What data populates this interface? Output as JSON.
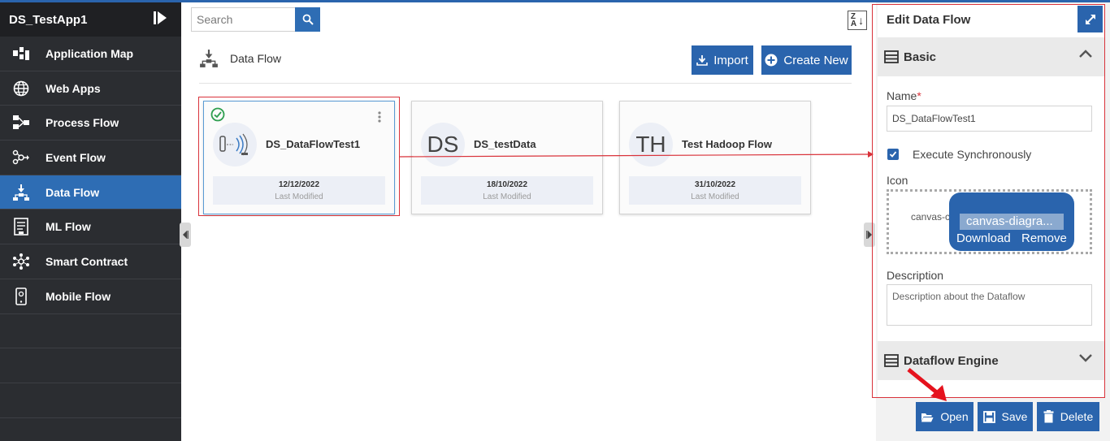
{
  "app": {
    "title": "DS_TestApp1"
  },
  "sidebar": {
    "items": [
      {
        "label": "Application Map",
        "icon": "application-map-icon",
        "active": false
      },
      {
        "label": "Web Apps",
        "icon": "globe-icon",
        "active": false
      },
      {
        "label": "Process Flow",
        "icon": "process-flow-icon",
        "active": false
      },
      {
        "label": "Event Flow",
        "icon": "event-flow-icon",
        "active": false
      },
      {
        "label": "Data Flow",
        "icon": "data-flow-icon",
        "active": true
      },
      {
        "label": "ML Flow",
        "icon": "ml-flow-icon",
        "active": false
      },
      {
        "label": "Smart Contract",
        "icon": "smart-contract-icon",
        "active": false
      },
      {
        "label": "Mobile Flow",
        "icon": "mobile-flow-icon",
        "active": false
      }
    ]
  },
  "search": {
    "placeholder": "Search",
    "value": ""
  },
  "main": {
    "title": "Data Flow",
    "import_label": "Import",
    "create_label": "Create New",
    "cards": [
      {
        "name": "DS_DataFlowTest1",
        "initials": "",
        "date": "12/12/2022",
        "modified_label": "Last Modified",
        "selected": true
      },
      {
        "name": "DS_testData",
        "initials": "DS",
        "date": "18/10/2022",
        "modified_label": "Last Modified",
        "selected": false
      },
      {
        "name": "Test Hadoop Flow",
        "initials": "TH",
        "date": "31/10/2022",
        "modified_label": "Last Modified",
        "selected": false
      }
    ]
  },
  "panel": {
    "title": "Edit Data Flow",
    "basic_label": "Basic",
    "name_label": "Name",
    "name_required": "*",
    "name_value": "DS_DataFlowTest1",
    "execute_label": "Execute Synchronously",
    "execute_checked": true,
    "icon_label": "Icon",
    "icon_file_partial": "canvas-c",
    "icon_file_name": "canvas-diagra...",
    "download_label": "Download",
    "remove_label": "Remove",
    "description_label": "Description",
    "description_placeholder": "Description about the Dataflow",
    "engine_label": "Dataflow Engine"
  },
  "actions": {
    "open_label": "Open",
    "save_label": "Save",
    "delete_label": "Delete"
  },
  "colors": {
    "accent": "#2a64ad",
    "sidebar": "#2b2d31",
    "highlight": "#d9323a"
  }
}
